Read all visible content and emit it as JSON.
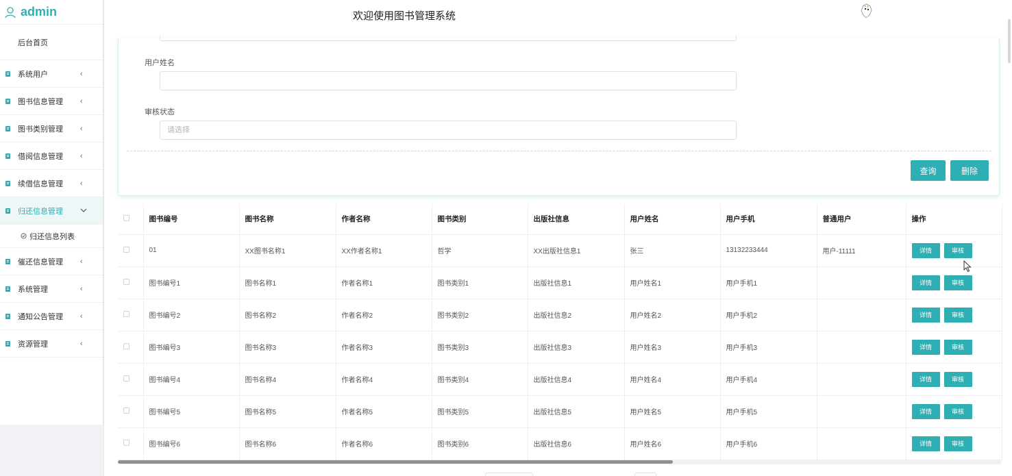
{
  "sidebar": {
    "username": "admin",
    "home": "后台首页",
    "items": [
      {
        "label": "系统用户"
      },
      {
        "label": "图书信息管理"
      },
      {
        "label": "图书类别管理"
      },
      {
        "label": "借阅信息管理"
      },
      {
        "label": "续借信息管理"
      },
      {
        "label": "归还信息管理"
      },
      {
        "label": "催还信息管理"
      },
      {
        "label": "系统管理"
      },
      {
        "label": "通知公告管理"
      },
      {
        "label": "资源管理"
      }
    ],
    "active_sub": "归还信息列表"
  },
  "header": {
    "title": "欢迎使用图书管理系统"
  },
  "search": {
    "user_name_label": "用户姓名",
    "user_name_value": "",
    "audit_status_label": "审核状态",
    "audit_status_placeholder": "请选择",
    "query_button": "查询",
    "delete_button": "删除"
  },
  "table": {
    "columns": [
      "图书编号",
      "图书名称",
      "作者名称",
      "图书类别",
      "出版社信息",
      "用户姓名",
      "用户手机",
      "普通用户",
      "操作"
    ],
    "rows": [
      [
        "01",
        "XX图书名称1",
        "XX作者名称1",
        "哲学",
        "XX出版社信息1",
        "张三",
        "13132233444",
        "用户-11111"
      ],
      [
        "图书编号1",
        "图书名称1",
        "作者名称1",
        "图书类别1",
        "出版社信息1",
        "用户姓名1",
        "用户手机1",
        ""
      ],
      [
        "图书编号2",
        "图书名称2",
        "作者名称2",
        "图书类别2",
        "出版社信息2",
        "用户姓名2",
        "用户手机2",
        ""
      ],
      [
        "图书编号3",
        "图书名称3",
        "作者名称3",
        "图书类别3",
        "出版社信息3",
        "用户姓名3",
        "用户手机3",
        ""
      ],
      [
        "图书编号4",
        "图书名称4",
        "作者名称4",
        "图书类别4",
        "出版社信息4",
        "用户姓名4",
        "用户手机4",
        ""
      ],
      [
        "图书编号5",
        "图书名称5",
        "作者名称5",
        "图书类别5",
        "出版社信息5",
        "用户姓名5",
        "用户手机5",
        ""
      ],
      [
        "图书编号6",
        "图书名称6",
        "作者名称6",
        "图书类别6",
        "出版社信息6",
        "用户姓名6",
        "用户手机6",
        ""
      ]
    ],
    "detail_label": "详情",
    "audit_label": "审核"
  },
  "colors": {
    "accent": "#2eafb3"
  }
}
